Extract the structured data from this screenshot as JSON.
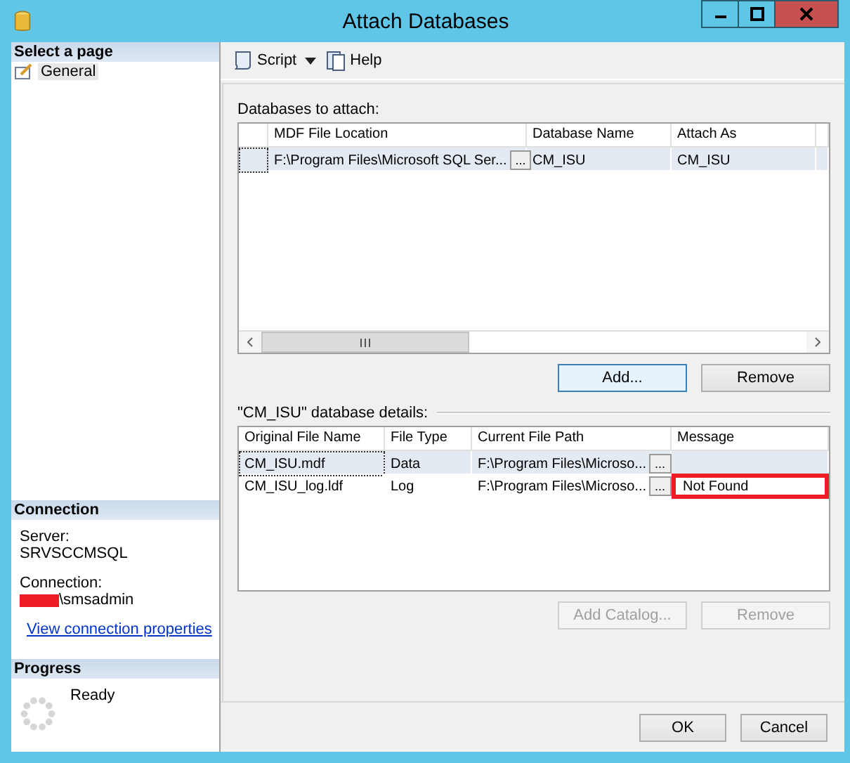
{
  "window": {
    "title": "Attach Databases"
  },
  "sidebar": {
    "heading": "Select a page",
    "items": [
      {
        "label": "General",
        "selected": true
      }
    ]
  },
  "connection": {
    "heading": "Connection",
    "server_label": "Server:",
    "server": "SRVSCCMSQL",
    "connection_label": "Connection:",
    "connection_user": "\\smsadmin",
    "link": "View connection properties"
  },
  "progress": {
    "heading": "Progress",
    "status": "Ready"
  },
  "toolbar": {
    "items": [
      {
        "label": "Script",
        "kind": "script"
      },
      {
        "label": "Help",
        "kind": "help"
      }
    ]
  },
  "attach": {
    "label": "Databases to attach:",
    "columns": [
      "MDF File Location",
      "Database Name",
      "Attach As"
    ],
    "rows": [
      {
        "cells": [
          "F:\\Program Files\\Microsoft SQL Ser...",
          "CM_ISU",
          "CM_ISU"
        ],
        "browse": "...",
        "selected": true
      }
    ],
    "buttons": [
      {
        "label": "Add...",
        "disabled": false,
        "focused": true
      },
      {
        "label": "Remove",
        "disabled": false,
        "focused": false
      }
    ]
  },
  "details": {
    "label": "\"CM_ISU\" database details:",
    "columns": [
      "Original File Name",
      "File Type",
      "Current File Path",
      "Message"
    ],
    "rows": [
      {
        "cells": [
          "CM_ISU.mdf",
          "Data",
          "F:\\Program Files\\Microso..."
        ],
        "browse": "...",
        "message": "",
        "selected": true,
        "highlighted": false
      },
      {
        "cells": [
          "CM_ISU_log.ldf",
          "Log",
          "F:\\Program Files\\Microso..."
        ],
        "browse": "...",
        "message": "Not Found",
        "selected": false,
        "highlighted": true
      }
    ],
    "buttons": [
      {
        "label": "Add Catalog...",
        "disabled": true
      },
      {
        "label": "Remove",
        "disabled": true
      }
    ]
  },
  "footer": {
    "buttons": [
      {
        "label": "OK"
      },
      {
        "label": "Cancel"
      }
    ]
  }
}
